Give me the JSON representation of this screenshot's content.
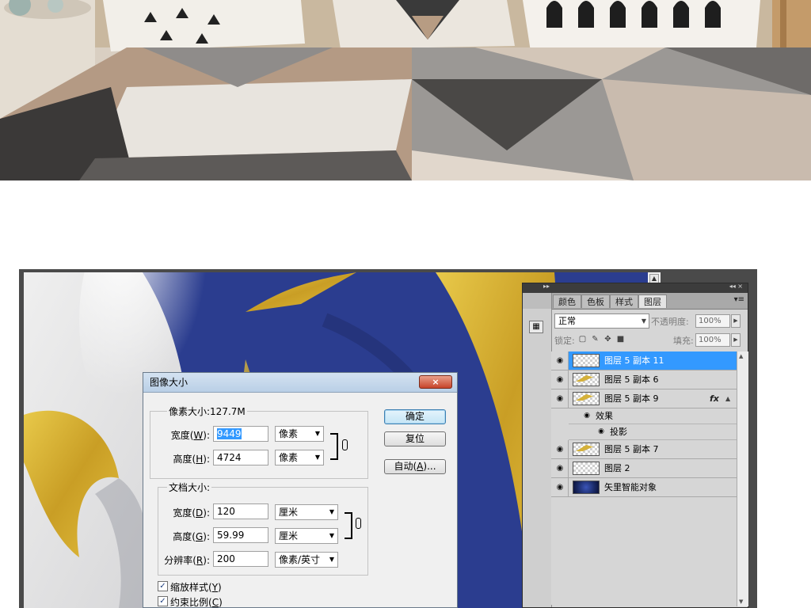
{
  "top_photo": {
    "description_icon": "bedroom-photo"
  },
  "layers_panel": {
    "tabs": [
      {
        "label": "颜色",
        "active": false
      },
      {
        "label": "色板",
        "active": false
      },
      {
        "label": "样式",
        "active": false
      },
      {
        "label": "图层",
        "active": true
      }
    ],
    "menu_glyph": "▾≡",
    "titlebar_left_glyph": "▸▸",
    "titlebar_right_glyph": "◂◂  ×",
    "blend_mode": "正常",
    "opacity_label": "不透明度:",
    "opacity_value": "100%",
    "lock_label": "锁定:",
    "fill_label": "填充:",
    "fill_value": "100%",
    "layers": [
      {
        "name": "图层 5 副本 11",
        "selected": true,
        "thumb": "transparent",
        "fx": false
      },
      {
        "name": "图层 5 副本 6",
        "selected": false,
        "thumb": "gold",
        "fx": false
      },
      {
        "name": "图层 5 副本 9",
        "selected": false,
        "thumb": "gold",
        "fx": true
      },
      {
        "name": "图层 5 副本 7",
        "selected": false,
        "thumb": "gold",
        "fx": false
      },
      {
        "name": "图层 2",
        "selected": false,
        "thumb": "transparent",
        "fx": false
      },
      {
        "name": "矢里智能对象",
        "selected": false,
        "thumb": "space",
        "fx": false
      }
    ],
    "effects_label": "效果",
    "drop_shadow_label": "投影",
    "fx_symbol": "fx"
  },
  "image_size_dialog": {
    "title": "图像大小",
    "close_glyph": "×",
    "pixel_dimensions_title": "像素大小:127.7M",
    "pixel_width_label": "宽度",
    "pixel_width_key": "W",
    "pixel_width_value": "9449",
    "pixel_width_unit": "像素",
    "pixel_height_label": "高度",
    "pixel_height_key": "H",
    "pixel_height_value": "4724",
    "pixel_height_unit": "像素",
    "document_size_title": "文档大小:",
    "doc_width_label": "宽度",
    "doc_width_key": "D",
    "doc_width_value": "120",
    "doc_width_unit": "厘米",
    "doc_height_label": "高度",
    "doc_height_key": "G",
    "doc_height_value": "59.99",
    "doc_height_unit": "厘米",
    "resolution_label": "分辨率",
    "resolution_key": "R",
    "resolution_value": "200",
    "resolution_unit": "像素/英寸",
    "ok_button": "确定",
    "reset_button": "复位",
    "auto_button_label": "自动",
    "auto_button_key": "A",
    "auto_button_suffix": "...",
    "scale_styles_label": "缩放样式",
    "scale_styles_key": "Y",
    "scale_styles_checked": true,
    "constrain_label": "约束比例",
    "constrain_key": "C",
    "constrain_checked": true
  },
  "colors": {
    "canvas_navy": "#2b3d8f",
    "gold": "#d2ac33",
    "selection_blue": "#3399ff",
    "dialog_bg": "#f0f0f0"
  }
}
